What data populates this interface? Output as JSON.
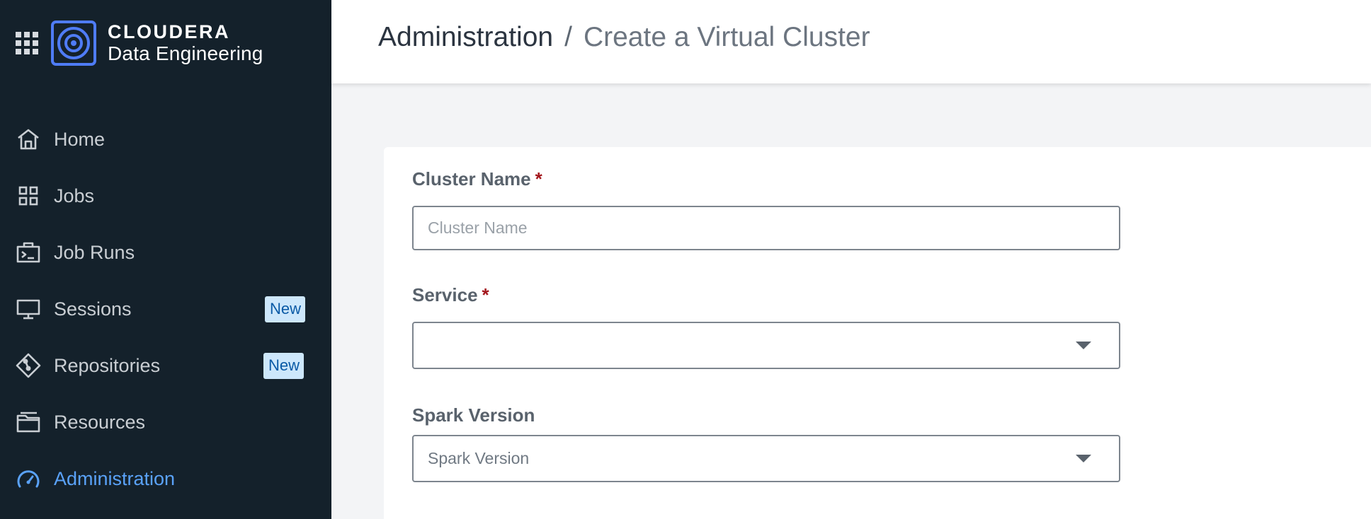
{
  "brand": {
    "company": "CLOUDERA",
    "product": "Data Engineering",
    "apps_icon": "apps-grid-icon",
    "logo_icon": "cloudera-logo-icon"
  },
  "nav": {
    "items": [
      {
        "label": "Home",
        "icon": "home-icon"
      },
      {
        "label": "Jobs",
        "icon": "grid-icon"
      },
      {
        "label": "Job Runs",
        "icon": "terminal-briefcase-icon"
      },
      {
        "label": "Sessions",
        "icon": "monitor-icon",
        "badge": "New"
      },
      {
        "label": "Repositories",
        "icon": "git-icon",
        "badge": "New"
      },
      {
        "label": "Resources",
        "icon": "folder-icon"
      },
      {
        "label": "Administration",
        "icon": "gauge-icon",
        "active": true
      }
    ]
  },
  "breadcrumb": {
    "root": "Administration",
    "separator": "/",
    "current": "Create a Virtual Cluster"
  },
  "form": {
    "cluster_name": {
      "label": "Cluster Name",
      "required_mark": "*",
      "placeholder": "Cluster Name",
      "value": ""
    },
    "service": {
      "label": "Service",
      "required_mark": "*",
      "value": ""
    },
    "spark_version": {
      "label": "Spark Version",
      "value": "Spark Version"
    }
  },
  "colors": {
    "sidebar_bg": "#14212b",
    "active_accent": "#5aa2f8",
    "badge_bg": "#cde7fb",
    "required": "#a3161c",
    "logo_blue": "#4f7cf6"
  }
}
